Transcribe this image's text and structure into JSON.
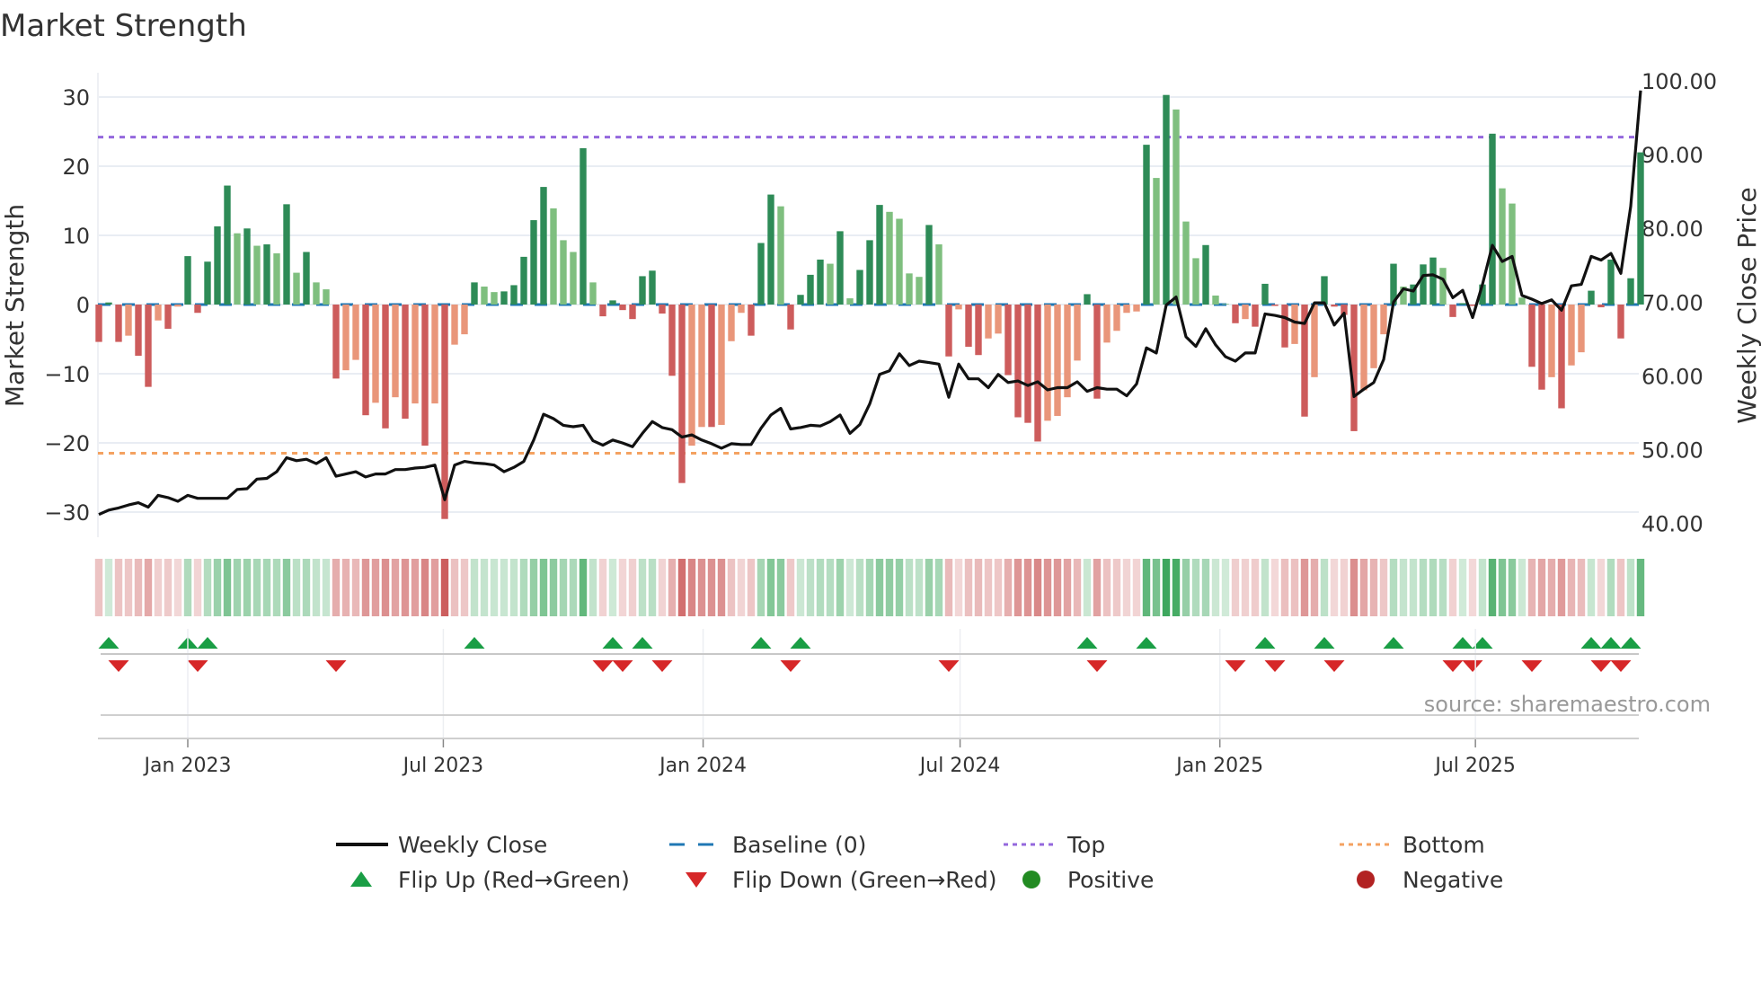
{
  "chart_data": {
    "type": "bar",
    "title": "Market Strength",
    "ylabel": "Market Strength",
    "y2label": "Weekly Close Price",
    "source": "source: sharemaestro.com",
    "start_date": "2022-10-30",
    "frequency": "weekly",
    "ylim": [
      -33,
      32
    ],
    "y2lim": [
      37.2,
      103.2
    ],
    "yticks": [
      -30,
      -20,
      -10,
      0,
      10,
      20,
      30
    ],
    "ytick_labels": [
      "−30",
      "−20",
      "−10",
      "0",
      "10",
      "20",
      "30"
    ],
    "y2ticks": [
      40,
      50,
      60,
      70,
      80,
      90,
      100
    ],
    "y2tick_labels": [
      "40.00",
      "50.00",
      "60.00",
      "70.00",
      "80.00",
      "90.00",
      "100.00"
    ],
    "xticks": [
      {
        "date": "2023-01-01",
        "label": "Jan 2023"
      },
      {
        "date": "2023-07-01",
        "label": "Jul 2023"
      },
      {
        "date": "2024-01-01",
        "label": "Jan 2024"
      },
      {
        "date": "2024-07-01",
        "label": "Jul 2024"
      },
      {
        "date": "2025-01-01",
        "label": "Jan 2025"
      },
      {
        "date": "2025-07-01",
        "label": "Jul 2025"
      }
    ],
    "top_level": 24.2,
    "bottom_level": -21.5,
    "baseline": 0,
    "strength": [
      -5.4,
      0.3,
      -5.4,
      -4.5,
      -7.4,
      -11.9,
      -2.3,
      -3.5,
      -0.3,
      7.0,
      -1.2,
      6.2,
      11.3,
      17.2,
      10.3,
      11.0,
      8.5,
      8.7,
      7.4,
      14.5,
      4.6,
      7.6,
      3.2,
      2.2,
      -10.7,
      -9.5,
      -8.0,
      -16.0,
      -14.2,
      -17.9,
      -13.4,
      -16.5,
      -14.3,
      -20.4,
      -14.3,
      -31.0,
      -5.8,
      -4.3,
      3.2,
      2.6,
      1.8,
      1.9,
      2.8,
      6.9,
      12.2,
      17.0,
      13.9,
      9.3,
      7.6,
      22.6,
      3.2,
      -1.7,
      0.6,
      -0.8,
      -2.1,
      4.1,
      4.9,
      -1.3,
      -10.3,
      -25.8,
      -20.4,
      -17.7,
      -17.7,
      -17.4,
      -5.3,
      -1.2,
      -4.5,
      8.9,
      15.9,
      14.2,
      -3.6,
      1.4,
      4.3,
      6.5,
      5.9,
      10.6,
      0.9,
      5.0,
      9.3,
      14.4,
      13.4,
      12.4,
      4.5,
      4.0,
      11.5,
      8.7,
      -7.5,
      -0.7,
      -6.1,
      -7.3,
      -4.9,
      -4.2,
      -10.2,
      -16.3,
      -17.1,
      -19.8,
      -16.8,
      -16.1,
      -13.4,
      -8.1,
      1.5,
      -13.6,
      -5.5,
      -3.8,
      -1.2,
      -1.0,
      23.1,
      18.3,
      30.3,
      28.2,
      12.0,
      6.7,
      8.6,
      1.3,
      0.1,
      -2.7,
      -2.1,
      -3.2,
      3.0,
      -0.2,
      -6.2,
      -5.7,
      -16.2,
      -10.5,
      4.1,
      -0.3,
      -1.5,
      -18.3,
      -12.4,
      -9.2,
      -4.3,
      5.9,
      2.6,
      2.9,
      5.8,
      6.8,
      5.3,
      -1.8,
      0.2,
      -0.2,
      2.9,
      24.7,
      16.8,
      14.6,
      1.0,
      -9.0,
      -12.3,
      -10.5,
      -15.0,
      -8.8,
      -6.9,
      2.0,
      -0.4,
      6.5,
      -4.9,
      3.8,
      22.0
    ],
    "weekly_close": [
      41.2,
      41.8,
      42.1,
      42.5,
      42.8,
      42.2,
      43.8,
      43.5,
      43.0,
      43.8,
      43.4,
      43.4,
      43.4,
      43.4,
      44.6,
      44.7,
      46.0,
      46.1,
      47.0,
      48.9,
      48.5,
      48.7,
      48.1,
      48.9,
      46.4,
      46.7,
      47.0,
      46.3,
      46.7,
      46.7,
      47.3,
      47.3,
      47.5,
      47.6,
      47.9,
      43.2,
      47.9,
      48.4,
      48.2,
      48.1,
      47.9,
      47.0,
      47.6,
      48.4,
      51.3,
      54.8,
      54.2,
      53.3,
      53.1,
      53.3,
      51.2,
      50.6,
      51.3,
      50.9,
      50.4,
      52.2,
      53.8,
      53.0,
      52.7,
      51.7,
      52.0,
      51.3,
      50.8,
      50.2,
      50.8,
      50.7,
      50.7,
      52.9,
      54.7,
      55.6,
      52.8,
      53.0,
      53.3,
      53.2,
      53.8,
      54.7,
      52.2,
      53.4,
      56.2,
      60.2,
      60.7,
      63.0,
      61.4,
      62.0,
      61.8,
      61.6,
      57.1,
      61.6,
      59.6,
      59.6,
      58.4,
      60.2,
      59.1,
      59.3,
      58.7,
      59.2,
      58.1,
      58.4,
      58.4,
      59.2,
      57.9,
      58.4,
      58.2,
      58.2,
      57.3,
      58.9,
      63.8,
      63.1,
      69.6,
      70.7,
      65.3,
      64.0,
      66.4,
      64.2,
      62.6,
      62.0,
      63.1,
      63.1,
      68.4,
      68.2,
      67.9,
      67.3,
      67.1,
      69.9,
      69.9,
      66.9,
      68.5,
      57.2,
      58.2,
      59.1,
      62.2,
      70.0,
      71.8,
      71.5,
      73.6,
      73.7,
      73.1,
      70.6,
      71.6,
      67.9,
      72.4,
      77.7,
      75.5,
      76.2,
      70.9,
      70.4,
      69.8,
      70.3,
      68.9,
      72.2,
      72.4,
      76.2,
      75.7,
      76.6,
      73.9,
      83.0,
      98.7
    ],
    "colors": {
      "rising_positive": "#2e8b57",
      "falling_positive": "#7fbf7f",
      "falling_negative": "#cd5c5c",
      "rising_negative": "#e9967a",
      "baseline": "#1f77b4",
      "top": "#9467dd",
      "bottom": "#f4a261",
      "close": "#111111",
      "flip_up": "#1a9e45",
      "flip_down": "#d62728",
      "positive": "#228b22",
      "negative": "#b22222"
    },
    "legend_position": "bottom-center",
    "legend": [
      {
        "label": "Weekly Close",
        "kind": "line"
      },
      {
        "label": "Baseline (0)",
        "kind": "dash"
      },
      {
        "label": "Top",
        "kind": "dot-purple"
      },
      {
        "label": "Bottom",
        "kind": "dot-orange"
      },
      {
        "label": "Flip Up (Red→Green)",
        "kind": "triangle-up"
      },
      {
        "label": "Flip Down (Green→Red)",
        "kind": "triangle-down"
      },
      {
        "label": "Positive",
        "kind": "circle-green"
      },
      {
        "label": "Negative",
        "kind": "circle-red"
      }
    ]
  }
}
